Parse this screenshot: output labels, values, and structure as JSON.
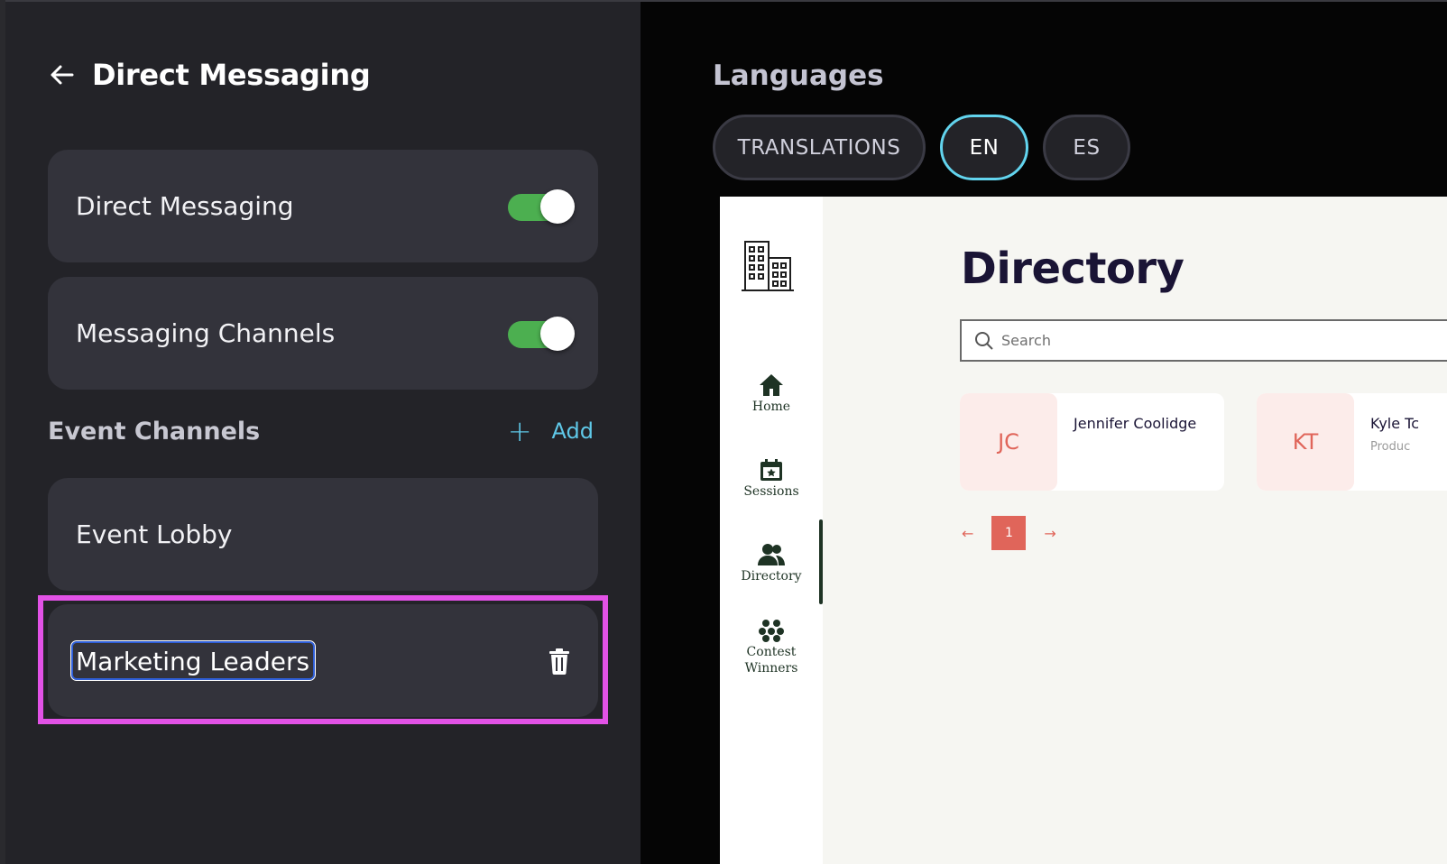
{
  "left_panel": {
    "title": "Direct Messaging",
    "settings": [
      {
        "label": "Direct Messaging",
        "enabled": true
      },
      {
        "label": "Messaging Channels",
        "enabled": true
      }
    ],
    "event_channels": {
      "title": "Event Channels",
      "add_label": "Add",
      "channels": [
        {
          "name": "Event Lobby"
        },
        {
          "name": "Marketing Leaders",
          "editing": true
        }
      ]
    }
  },
  "languages": {
    "title": "Languages",
    "options": [
      "TRANSLATIONS",
      "EN",
      "ES"
    ],
    "selected": "EN"
  },
  "preview": {
    "nav": [
      {
        "label": "Home",
        "icon": "home-icon"
      },
      {
        "label": "Sessions",
        "icon": "calendar-star-icon"
      },
      {
        "label": "Directory",
        "icon": "people-icon"
      },
      {
        "label": "Contest Winners",
        "icon": "dots-cluster-icon"
      }
    ],
    "page_title": "Directory",
    "search_placeholder": "Search",
    "people": [
      {
        "initials": "JC",
        "name": "Jennifer Coolidge",
        "subtitle": ""
      },
      {
        "initials": "KT",
        "name": "Kyle Tc",
        "subtitle": "Produc"
      }
    ],
    "current_page": "1"
  },
  "colors": {
    "accent": "#62d4ee",
    "toggle_on": "#4caf50",
    "highlight": "#e252e6",
    "brand_coral": "#e0655a"
  }
}
